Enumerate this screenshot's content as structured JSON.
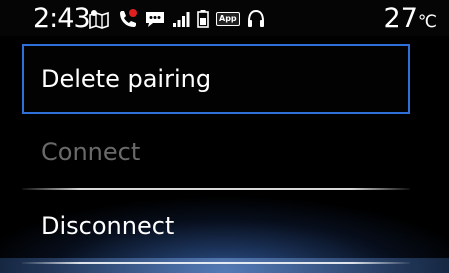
{
  "status_bar": {
    "time": "2:43",
    "temperature_value": "27",
    "temperature_unit": "℃",
    "app_badge": "App",
    "icons": [
      "navigation-map-icon",
      "phone-missed-call-icon",
      "message-icon",
      "signal-strength-icon",
      "battery-icon",
      "app-icon",
      "headphones-icon"
    ]
  },
  "menu": {
    "items": [
      {
        "label": "Delete pairing",
        "state": "focused"
      },
      {
        "label": "Connect",
        "state": "disabled"
      },
      {
        "label": "Disconnect",
        "state": "enabled"
      }
    ]
  },
  "colors": {
    "focus_border": "#2f6fd8",
    "disabled_text": "#6a6a6a",
    "text": "#ffffff",
    "background": "#000000",
    "missed_call_badge": "#e02020"
  }
}
